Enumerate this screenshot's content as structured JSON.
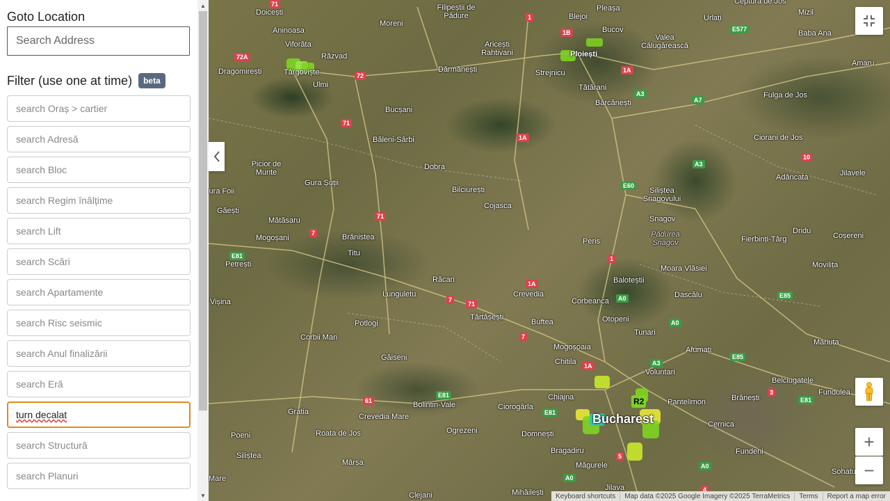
{
  "sidebar": {
    "goto_title": "Goto Location",
    "address_placeholder": "Search Address",
    "filter_title": "Filter (use one at time)",
    "beta_label": "beta",
    "filters": [
      {
        "placeholder": "search Oraș > cartier",
        "value": ""
      },
      {
        "placeholder": "search Adresă",
        "value": ""
      },
      {
        "placeholder": "search Bloc",
        "value": ""
      },
      {
        "placeholder": "search Regim înălțime",
        "value": ""
      },
      {
        "placeholder": "search Lift",
        "value": ""
      },
      {
        "placeholder": "search Scări",
        "value": ""
      },
      {
        "placeholder": "search Apartamente",
        "value": ""
      },
      {
        "placeholder": "search Risc seismic",
        "value": ""
      },
      {
        "placeholder": "search Anul finalizării",
        "value": ""
      },
      {
        "placeholder": "search Eră",
        "value": ""
      },
      {
        "placeholder": "",
        "value": "turn decalat"
      },
      {
        "placeholder": "search Structură",
        "value": ""
      },
      {
        "placeholder": "search Planuri",
        "value": ""
      }
    ]
  },
  "map": {
    "places": [
      "Doicești",
      "Aninoasa",
      "Viforâta",
      "Răzvad",
      "Dragomirești",
      "Târgoviște",
      "Ulmi",
      "Filipeștii de Pădure",
      "Moreni",
      "Aricești Rahtivani",
      "Dărmănești",
      "Bucov",
      "Pleașa",
      "Blejoi",
      "Ploiești",
      "Valea Călugărească",
      "Urlați",
      "Ceptura de Jos",
      "Mizil",
      "Baba Ana",
      "Amaru",
      "Strejnicu",
      "Tătărani",
      "Bărcănești",
      "Fulga de Jos",
      "Bucșani",
      "Băleni-Sârbi",
      "Ciorani de Jos",
      "Picior de Munte",
      "Dobra",
      "Gura Șuții",
      "Bilciurești",
      "Cojasca",
      "Adâncata",
      "Jilavele",
      "Gura Foii",
      "Găești",
      "Siliștea Snagovului",
      "Mătăsaru",
      "Snagov",
      "Pădurea Snagov",
      "Brănistea",
      "Mogoșani",
      "Dridu",
      "Fierbinți-Târg",
      "Coșereni",
      "Peris",
      "Petrești",
      "Titu",
      "Moara Vlăsiei",
      "Movilița",
      "Baloteștii",
      "Răcari",
      "Lunguletu",
      "Crevedia",
      "Corbeanca",
      "Dascălu",
      "Vișina",
      "Tărtășești",
      "Buftea",
      "Otopeni",
      "Tunari",
      "Potlogi",
      "Mâriuța",
      "Corbii Mari",
      "Găiseni",
      "Mogoșoaia",
      "Afumați",
      "Chitila",
      "Voluntari",
      "Brănești",
      "Belciugatele",
      "Chiajna",
      "Pantelimon",
      "Fundulea",
      "Bolintin-Vale",
      "Ciorogârla",
      "Gratia",
      "Crevedia Mare",
      "Ogrezeni",
      "Domnești",
      "Cernica",
      "Poeni",
      "Roata de Jos",
      "Bragadiru",
      "Fundeni",
      "Siliștea",
      "Mârșa",
      "Măgurele",
      "Mare",
      "Clejani",
      "Mihăilești",
      "Jilava",
      "Sohatu"
    ],
    "city_label": "Bucharest",
    "cluster_label": "R2",
    "road_badges": [
      "71",
      "1",
      "1B",
      "72A",
      "72",
      "1A",
      "A3",
      "A7",
      "E577",
      "71",
      "1A",
      "10",
      "A3",
      "E60",
      "7",
      "71",
      "1",
      "E81",
      "1A",
      "7",
      "71",
      "A0",
      "A0",
      "E85",
      "7",
      "1A",
      "A3",
      "E81",
      "E85",
      "E81",
      "61",
      "3",
      "E81",
      "A0",
      "5",
      "A0",
      "4"
    ],
    "attribution": [
      "Keyboard shortcuts",
      "Map data ©2025 Google Imagery ©2025 TerraMetrics",
      "Terms",
      "Report a map error"
    ],
    "icons": {
      "fullscreen": "fullscreen-icon",
      "pegman": "pegman-icon",
      "zoom_in": "+",
      "zoom_out": "−",
      "collapse": "chevron-left-icon"
    }
  }
}
